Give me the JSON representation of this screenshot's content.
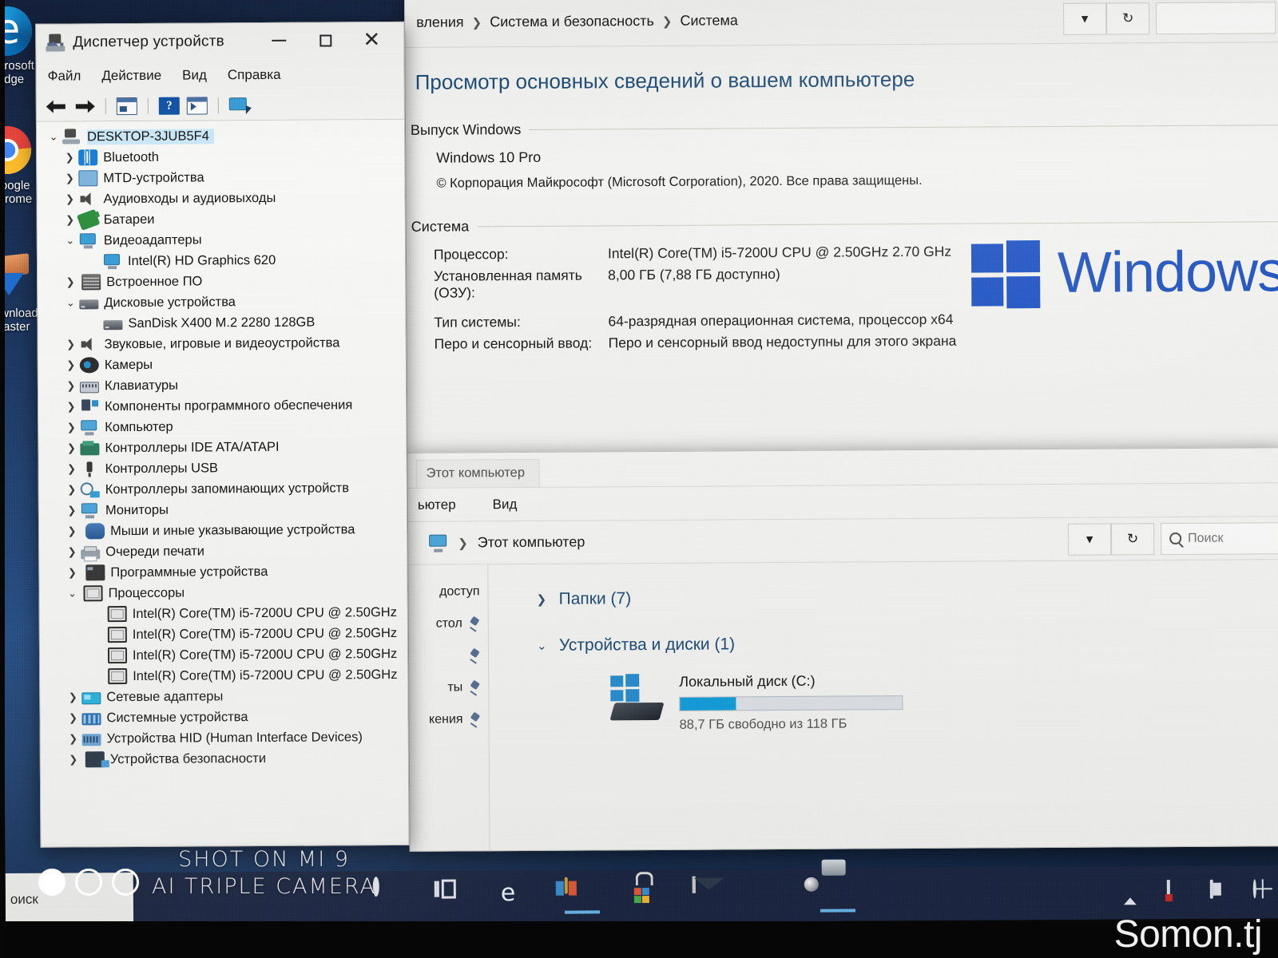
{
  "desktop": {
    "icons": [
      {
        "label": "Microsoft Edge",
        "icon": "edge-icon"
      },
      {
        "label": "Google Chrome",
        "icon": "chrome-icon"
      },
      {
        "label": "Download Master",
        "icon": "download-master-icon"
      }
    ]
  },
  "device_manager": {
    "title": "Диспетчер устройств",
    "window_buttons": {
      "minimize": "—",
      "maximize": "□",
      "close": "✕"
    },
    "menu": [
      "Файл",
      "Действие",
      "Вид",
      "Справка"
    ],
    "toolbar": [
      "back-arrow-icon",
      "forward-arrow-icon",
      "properties-icon",
      "help-icon",
      "scan-icon",
      "network-icon"
    ],
    "tree": [
      {
        "label": "DESKTOP-3JUB5F4",
        "depth": 0,
        "state": "expanded",
        "icon": "computer-icon",
        "selected": true
      },
      {
        "label": "Bluetooth",
        "depth": 1,
        "state": "collapsed",
        "icon": "bluetooth-icon"
      },
      {
        "label": "MTD-устройства",
        "depth": 1,
        "state": "collapsed",
        "icon": "mtd-icon"
      },
      {
        "label": "Аудиовходы и аудиовыходы",
        "depth": 1,
        "state": "collapsed",
        "icon": "speaker-icon"
      },
      {
        "label": "Батареи",
        "depth": 1,
        "state": "collapsed",
        "icon": "battery-icon"
      },
      {
        "label": "Видеоадаптеры",
        "depth": 1,
        "state": "expanded",
        "icon": "display-adapter-icon"
      },
      {
        "label": "Intel(R) HD Graphics 620",
        "depth": 2,
        "state": "leaf",
        "icon": "display-adapter-icon"
      },
      {
        "label": "Встроенное ПО",
        "depth": 1,
        "state": "collapsed",
        "icon": "firmware-icon"
      },
      {
        "label": "Дисковые устройства",
        "depth": 1,
        "state": "expanded",
        "icon": "disk-icon"
      },
      {
        "label": "SanDisk X400 M.2 2280 128GB",
        "depth": 2,
        "state": "leaf",
        "icon": "disk-icon"
      },
      {
        "label": "Звуковые, игровые и видеоустройства",
        "depth": 1,
        "state": "collapsed",
        "icon": "speaker-icon"
      },
      {
        "label": "Камеры",
        "depth": 1,
        "state": "collapsed",
        "icon": "camera-icon"
      },
      {
        "label": "Клавиатуры",
        "depth": 1,
        "state": "collapsed",
        "icon": "keyboard-icon"
      },
      {
        "label": "Компоненты программного обеспечения",
        "depth": 1,
        "state": "collapsed",
        "icon": "software-component-icon"
      },
      {
        "label": "Компьютер",
        "depth": 1,
        "state": "collapsed",
        "icon": "monitor-icon"
      },
      {
        "label": "Контроллеры IDE ATA/ATAPI",
        "depth": 1,
        "state": "collapsed",
        "icon": "ide-controller-icon"
      },
      {
        "label": "Контроллеры USB",
        "depth": 1,
        "state": "collapsed",
        "icon": "usb-icon"
      },
      {
        "label": "Контроллеры запоминающих устройств",
        "depth": 1,
        "state": "collapsed",
        "icon": "storage-controller-icon"
      },
      {
        "label": "Мониторы",
        "depth": 1,
        "state": "collapsed",
        "icon": "monitor-icon"
      },
      {
        "label": "Мыши и иные указывающие устройства",
        "depth": 1,
        "state": "collapsed",
        "icon": "mouse-icon"
      },
      {
        "label": "Очереди печати",
        "depth": 1,
        "state": "collapsed",
        "icon": "printer-icon"
      },
      {
        "label": "Программные устройства",
        "depth": 1,
        "state": "collapsed",
        "icon": "software-device-icon"
      },
      {
        "label": "Процессоры",
        "depth": 1,
        "state": "expanded",
        "icon": "cpu-icon"
      },
      {
        "label": "Intel(R) Core(TM) i5-7200U CPU @ 2.50GHz",
        "depth": 2,
        "state": "leaf",
        "icon": "cpu-icon"
      },
      {
        "label": "Intel(R) Core(TM) i5-7200U CPU @ 2.50GHz",
        "depth": 2,
        "state": "leaf",
        "icon": "cpu-icon"
      },
      {
        "label": "Intel(R) Core(TM) i5-7200U CPU @ 2.50GHz",
        "depth": 2,
        "state": "leaf",
        "icon": "cpu-icon"
      },
      {
        "label": "Intel(R) Core(TM) i5-7200U CPU @ 2.50GHz",
        "depth": 2,
        "state": "leaf",
        "icon": "cpu-icon"
      },
      {
        "label": "Сетевые адаптеры",
        "depth": 1,
        "state": "collapsed",
        "icon": "network-adapter-icon"
      },
      {
        "label": "Системные устройства",
        "depth": 1,
        "state": "collapsed",
        "icon": "system-device-icon"
      },
      {
        "label": "Устройства HID (Human Interface Devices)",
        "depth": 1,
        "state": "collapsed",
        "icon": "hid-icon"
      },
      {
        "label": "Устройства безопасности",
        "depth": 1,
        "state": "collapsed",
        "icon": "security-device-icon"
      }
    ]
  },
  "system_window": {
    "breadcrumb": [
      "вления",
      "Система и безопасность",
      "Система"
    ],
    "address_dropdown_icon": "chevron-down-icon",
    "refresh_icon": "refresh-icon",
    "heading": "Просмотр основных сведений о вашем компьютере",
    "edition_section": "Выпуск Windows",
    "edition": "Windows 10 Pro",
    "copyright": "© Корпорация Майкрософт (Microsoft Corporation), 2020. Все права защищены.",
    "brand_text": "Windows",
    "system_section": "Система",
    "specs": [
      {
        "key": "Процессор:",
        "value": "Intel(R) Core(TM) i5-7200U CPU @ 2.50GHz   2.70 GHz"
      },
      {
        "key": "Установленная память (ОЗУ):",
        "value": "8,00 ГБ (7,88 ГБ доступно)"
      },
      {
        "key": "Тип системы:",
        "value": "64-разрядная операционная система, процессор x64"
      },
      {
        "key": "Перо и сенсорный ввод:",
        "value": "Перо и сенсорный ввод недоступны для этого экрана"
      }
    ]
  },
  "explorer": {
    "tab_label": "Этот компьютер",
    "ribbon_tabs": [
      "ьютер",
      "Вид"
    ],
    "breadcrumb": "Этот компьютер",
    "address_dropdown_icon": "chevron-down-icon",
    "refresh_icon": "refresh-icon",
    "search_placeholder": "Поиск",
    "search_icon": "search-icon",
    "sidebar_items": [
      "доступ",
      "стол",
      "",
      "ты",
      "кения"
    ],
    "groups": [
      {
        "label": "Папки (7)",
        "state": "collapsed"
      },
      {
        "label": "Устройства и диски (1)",
        "state": "expanded"
      }
    ],
    "drive": {
      "name": "Локальный диск (C:)",
      "free_text": "88,7 ГБ свободно из 118 ГБ",
      "used_percent": 25,
      "bar_color": "#15a0dd"
    }
  },
  "taskbar": {
    "search_text": "оиск",
    "items": [
      {
        "name": "cortana-icon",
        "active": false
      },
      {
        "name": "task-view-icon",
        "active": false
      },
      {
        "name": "internet-explorer-icon",
        "active": false
      },
      {
        "name": "store-app-icon",
        "active": true
      },
      {
        "name": "shopping-bag-icon",
        "active": false
      },
      {
        "name": "mail-icon",
        "active": false
      },
      {
        "name": "office-icon",
        "active": false
      },
      {
        "name": "camera-app-icon",
        "active": true
      }
    ],
    "tray": [
      "chevron-up-icon",
      "speaker-muted-icon",
      "battery-icon",
      "network-globe-icon"
    ]
  },
  "watermarks": {
    "shot_on_line1": "SHOT ON MI 9",
    "shot_on_line2": "AI TRIPLE CAMERA",
    "site": "Somon.tj"
  }
}
